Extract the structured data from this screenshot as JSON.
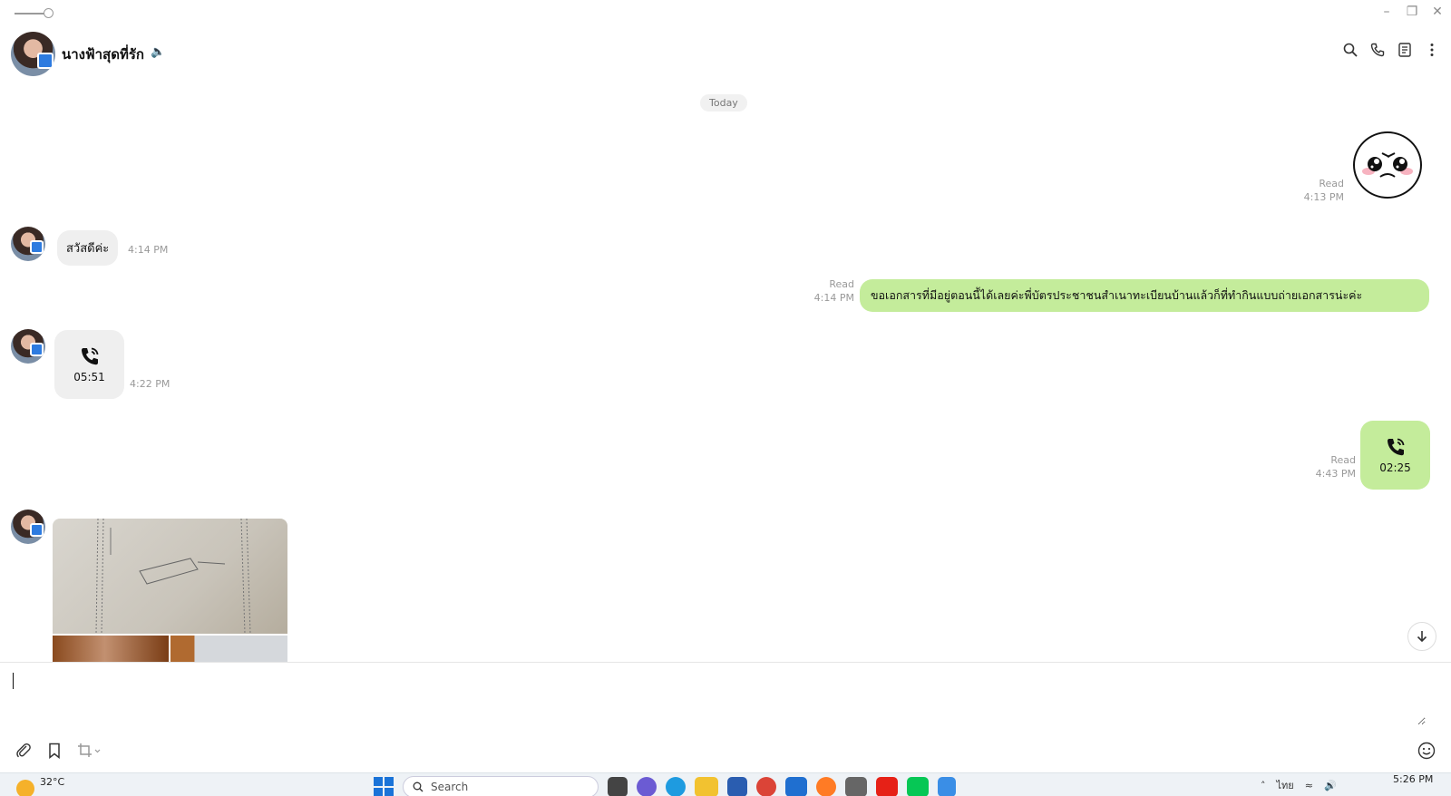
{
  "header": {
    "chat_name": "นางฟ้าสุดที่รัก"
  },
  "chat": {
    "date_label": "Today",
    "messages": {
      "sticker": {
        "status": "Read",
        "time": "4:13 PM"
      },
      "hello": {
        "text": "สวัสดีค่ะ",
        "time": "4:14 PM"
      },
      "request": {
        "text": "ขอเอกสารที่มีอยู่ตอนนี้ได้เลยค่ะพี่บัตรประชาชนสำเนาทะเบียนบ้านแล้วก็ที่ทำกินแบบถ่ายเอกสารน่ะค่ะ",
        "status": "Read",
        "time": "4:14 PM"
      },
      "call_in": {
        "duration": "05:51",
        "time": "4:22 PM"
      },
      "call_out": {
        "duration": "02:25",
        "status": "Read",
        "time": "4:43 PM"
      }
    }
  },
  "taskbar": {
    "temperature": "32°C",
    "search_placeholder": "Search",
    "language": "ไทย",
    "time": "5:26 PM"
  },
  "colors": {
    "outgoing_bubble": "#c4ec9b",
    "incoming_bubble": "#efefef",
    "accent": "#1a73d8"
  }
}
